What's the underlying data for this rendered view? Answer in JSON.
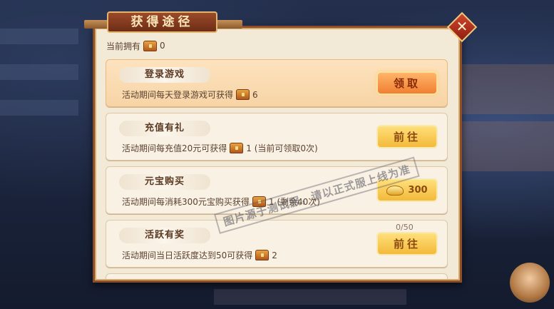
{
  "dialog": {
    "title": "获得途径",
    "close_icon": "close-icon"
  },
  "ownership": {
    "label": "当前拥有",
    "count": "0",
    "icon": "treasure-chest-icon"
  },
  "tasks": [
    {
      "name": "登录游戏",
      "desc": "活动期间每天登录游戏可获得",
      "reward": "6",
      "button": "领取"
    },
    {
      "name": "充值有礼",
      "desc": "活动期间每充值20元可获得",
      "reward": "1 (当前可领取0次)",
      "button": "前往"
    },
    {
      "name": "元宝购买",
      "desc": "活动期间每消耗300元宝购买获得",
      "reward": "1 (剩余40次)",
      "button": "300"
    },
    {
      "name": "活跃有奖",
      "desc": "活动期间当日活跃度达到50可获得",
      "reward": "2",
      "button": "前往",
      "progress": "0/50"
    }
  ],
  "watermark": "图片源于测试服，请以正式服上线为准",
  "colors": {
    "orange_button": "#f07f32",
    "yellow_button": "#f3b93a",
    "panel": "#f3e9d7",
    "frame": "#8b4e2b"
  }
}
